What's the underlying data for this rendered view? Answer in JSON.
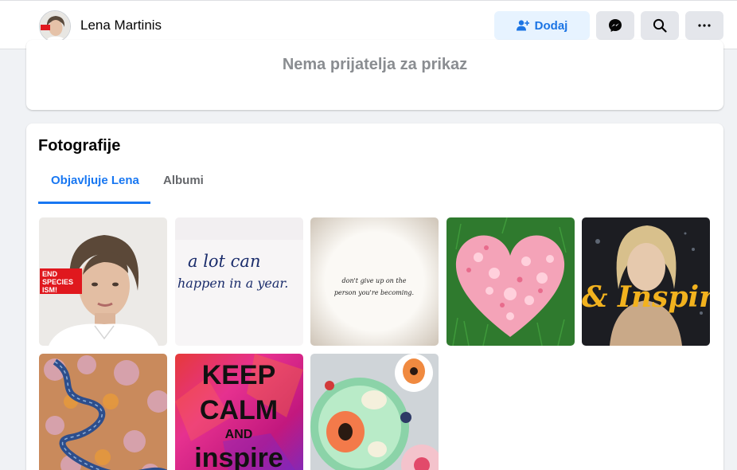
{
  "header": {
    "profile_name": "Lena Martinis",
    "add_button_label": "Dodaj",
    "messenger_icon": "messenger-icon",
    "search_icon": "search-icon",
    "more_icon": "more-dots-icon"
  },
  "friends": {
    "empty_text": "Nema prijatelja za prikaz"
  },
  "photos": {
    "title": "Fotografije",
    "tabs": [
      {
        "label": "Objavljuje Lena",
        "active": true
      },
      {
        "label": "Albumi",
        "active": false
      }
    ],
    "items": [
      {
        "name": "portrait",
        "badge_text": [
          "END",
          "SPECIES",
          "ISM!"
        ]
      },
      {
        "name": "handwriting-a-lot-can-happen",
        "text_lines": [
          "a lot can",
          "happen in a year."
        ]
      },
      {
        "name": "quote-dont-give-up",
        "text_lines": [
          "don't give up on the",
          "person you're becoming."
        ]
      },
      {
        "name": "petal-heart"
      },
      {
        "name": "inspire-woman",
        "text": "& Inspire"
      },
      {
        "name": "autumn-forest-road"
      },
      {
        "name": "keep-calm-inspire",
        "text_lines": [
          "KEEP",
          "CALM",
          "AND",
          "inspire"
        ]
      },
      {
        "name": "papaya-bowls"
      }
    ]
  },
  "colors": {
    "accent": "#1877f2",
    "add_button_bg": "#e7f3ff",
    "page_bg": "#f0f2f5",
    "secondary_text": "#65676b",
    "muted_text": "#8a8d91"
  }
}
